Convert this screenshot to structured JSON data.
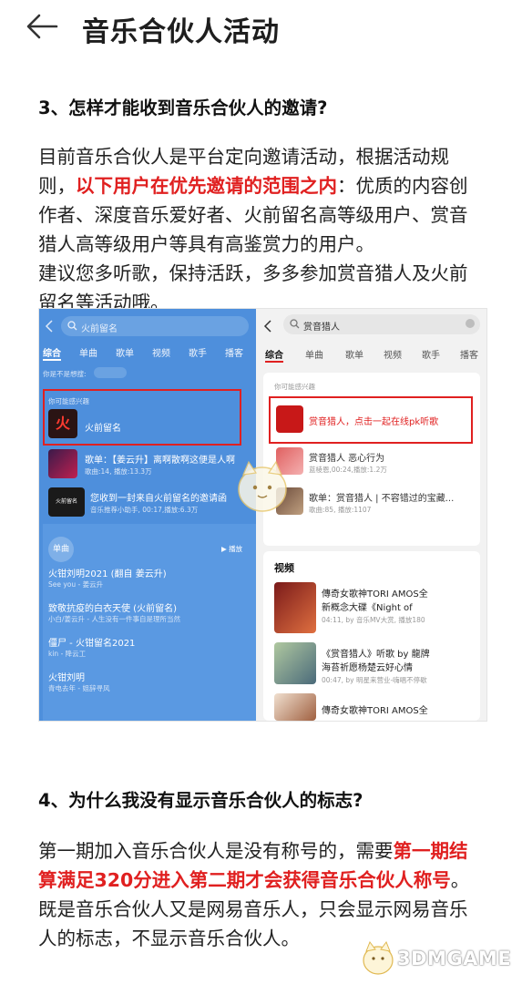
{
  "header": {
    "title": "音乐合伙人活动"
  },
  "q3": {
    "title": "3、怎样才能收到音乐合伙人的邀请?",
    "p1": "目前音乐合伙人是平台定向邀请活动，根据活动规",
    "p2_a": "则，",
    "p2_red": "以下用户在优先邀请的范围之内",
    "p2_b": "：优质的内容创",
    "p3": "作者、深度音乐爱好者、火前留名高等级用户、赏音",
    "p4": "猎人高等级用户等具有高鉴赏力的用户。",
    "p5": "建议您多听歌，保持活跃，多多参加赏音猎人及火前",
    "p6": "留名等活动哦。"
  },
  "left_app": {
    "search_text": "火前留名",
    "tabs": [
      "综合",
      "单曲",
      "歌单",
      "视频",
      "歌手",
      "播客"
    ],
    "hint": "你是不是想搜:",
    "section": "你可能感兴趣",
    "featured": "火前留名",
    "thumb_glyph": "火",
    "item1_title": "歌单：【姜云升】离啊散啊这便是人啊",
    "item1_sub": "歌曲:14, 播放:13.3万",
    "item2_title": "您收到一封来自火前留名的邀请函",
    "item2_sub": "音乐推荐小助手, 00:17,播放:6.3万",
    "thumb2_glyph": "火前留名",
    "single_label": "单曲",
    "play_label": "▶ 播放",
    "songs": [
      {
        "title": "火钳刘明2021 (翻自 姜云升)",
        "sub": "See you - 姜云升"
      },
      {
        "title": "致敬抗疫的白衣天使 (火前留名)",
        "sub": "小白/姜云升 - 人生没有一件事自是理所当然"
      },
      {
        "title": "僵尸 - 火钳留名2021",
        "sub": "kin - 降云工"
      },
      {
        "title": "火钳刘明",
        "sub": "青电去年 - 姐辞寻风"
      }
    ]
  },
  "right_app": {
    "search_text": "赏音猎人",
    "tabs": [
      "综合",
      "单曲",
      "歌单",
      "视频",
      "歌手",
      "播客"
    ],
    "section": "你可能感兴趣",
    "featured": "赏音猎人，点击一起在线pk听歌",
    "item1_title": "赏音猎人 恶心行为",
    "item1_sub": "蓝棱恩,00:24,播放:1.2万",
    "item2_title": "歌单：赏音猎人 | 不容错过的宝藏...",
    "item2_sub": "歌曲:85, 播放:1107",
    "video_header": "视频",
    "videos": [
      {
        "l1": "傳奇女歌神TORI AMOS全",
        "l2": "新概念大碟《Night of",
        "sub": "04:11, by 音乐MV大赏, 播放180"
      },
      {
        "l1": "《赏音猎人》听歌 by 龍牌",
        "l2": "海苔祈愿杨楚云好心情",
        "sub": "00:47, by 明星来营业-嗨唱不停歇"
      },
      {
        "l1": "傳奇女歌神TORI AMOS全",
        "l2": "",
        "sub": ""
      }
    ]
  },
  "q4": {
    "title": "4、为什么我没有显示音乐合伙人的标志?",
    "p1_a": "第一期加入音乐合伙人是没有称号的，需要",
    "p1_red": "第一期结",
    "p2_red": "算满足320分进入第二期才会获得音乐合伙人称号",
    "p2_b": "。",
    "p3": "既是音乐合伙人又是网易音乐人，只会显示网易音乐",
    "p4": "人的标志，不显示音乐合伙人。"
  },
  "watermark": {
    "text": "3DMGAME"
  },
  "colors": {
    "accent_red": "#e02020",
    "left_bg": "#4e8fdc",
    "right_bg": "#f2f2f2"
  }
}
